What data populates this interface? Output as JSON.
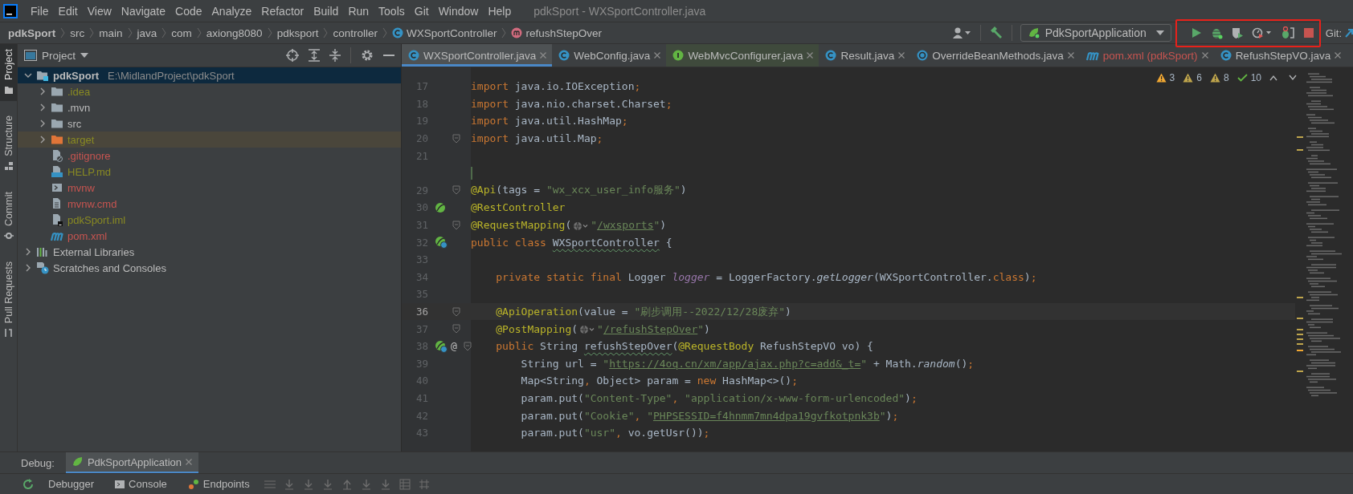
{
  "menu_bar": {
    "items": [
      "File",
      "Edit",
      "View",
      "Navigate",
      "Code",
      "Analyze",
      "Refactor",
      "Build",
      "Run",
      "Tools",
      "Git",
      "Window",
      "Help"
    ],
    "title": "pdkSport - WXSportController.java"
  },
  "breadcrumbs": [
    {
      "label": "pdkSport",
      "kind": "project"
    },
    {
      "label": "src",
      "kind": "folder"
    },
    {
      "label": "main",
      "kind": "folder"
    },
    {
      "label": "java",
      "kind": "folder"
    },
    {
      "label": "com",
      "kind": "folder"
    },
    {
      "label": "axiong8080",
      "kind": "folder"
    },
    {
      "label": "pdksport",
      "kind": "folder"
    },
    {
      "label": "controller",
      "kind": "folder"
    },
    {
      "label": "WXSportController",
      "kind": "class"
    },
    {
      "label": "refushStepOver",
      "kind": "method"
    }
  ],
  "toolbar": {
    "run_config": "PdkSportApplication",
    "git_label": "Git:"
  },
  "side_stripe": [
    {
      "label": "Project",
      "kind": "project",
      "selected": true
    },
    {
      "label": "Structure",
      "kind": "structure",
      "selected": false
    },
    {
      "label": "Commit",
      "kind": "commit",
      "selected": false
    },
    {
      "label": "Pull Requests",
      "kind": "pull_requests",
      "selected": false
    }
  ],
  "project_panel": {
    "title": "Project",
    "tree": [
      {
        "label": "pdkSport",
        "path": "E:\\MidlandProject\\pdkSport",
        "kind": "module",
        "expanded": true,
        "selected": true,
        "color": "#bbbbbb",
        "children": [
          {
            "label": ".idea",
            "kind": "folder",
            "expanded": false,
            "selected": false,
            "color": "#898a22"
          },
          {
            "label": ".mvn",
            "kind": "folder",
            "expanded": false,
            "selected": false,
            "color": "#bbbbbb"
          },
          {
            "label": "src",
            "kind": "folder",
            "expanded": false,
            "selected": false,
            "color": "#bbbbbb"
          },
          {
            "label": "target",
            "kind": "excluded_folder",
            "expanded": false,
            "selected": false,
            "color": "#898a22"
          },
          {
            "label": ".gitignore",
            "kind": "file_ignore",
            "selected": false,
            "color": "#c75450"
          },
          {
            "label": "HELP.md",
            "kind": "file_md",
            "selected": false,
            "color": "#898a22"
          },
          {
            "label": "mvnw",
            "kind": "file_script",
            "selected": false,
            "color": "#c75450"
          },
          {
            "label": "mvnw.cmd",
            "kind": "file_text",
            "selected": false,
            "color": "#c75450"
          },
          {
            "label": "pdkSport.iml",
            "kind": "file_iml",
            "selected": false,
            "color": "#898a22"
          },
          {
            "label": "pom.xml",
            "kind": "file_maven",
            "selected": false,
            "color": "#c75450"
          }
        ]
      },
      {
        "label": "External Libraries",
        "kind": "libraries",
        "expanded": false,
        "selected": false,
        "color": "#bbbbbb"
      },
      {
        "label": "Scratches and Consoles",
        "kind": "scratches",
        "expanded": false,
        "selected": false,
        "color": "#bbbbbb"
      }
    ]
  },
  "editor_tabs": [
    {
      "label": "WXSportController.java",
      "kind": "class",
      "selected": true,
      "color": "#bbbbbb"
    },
    {
      "label": "WebConfig.java",
      "kind": "class",
      "selected": false,
      "color": "#bbbbbb"
    },
    {
      "label": "WebMvcConfigurer.java",
      "kind": "interface_library",
      "selected": false,
      "color": "#bbbbbb"
    },
    {
      "label": "Result.java",
      "kind": "class",
      "selected": false,
      "color": "#bbbbbb"
    },
    {
      "label": "OverrideBeanMethods.java",
      "kind": "class_library",
      "selected": false,
      "color": "#bbbbbb"
    },
    {
      "label": "pom.xml (pdkSport)",
      "kind": "maven",
      "selected": false,
      "color": "#c75450"
    },
    {
      "label": "RefushStepVO.java",
      "kind": "class",
      "selected": false,
      "color": "#bbbbbb"
    }
  ],
  "inspections": [
    {
      "kind": "warning",
      "count": "3"
    },
    {
      "kind": "weak_warning",
      "count": "6"
    },
    {
      "kind": "weak_warning",
      "count": "8"
    },
    {
      "kind": "typo",
      "count": "10"
    }
  ],
  "code_lines": [
    {
      "kind": "code",
      "number": "17",
      "current": false,
      "fold": false,
      "tokens": [
        {
          "kind": "kw",
          "text": "import "
        },
        {
          "kind": "plain",
          "text": "java.io.IOException"
        },
        {
          "kind": "kw",
          "text": ";"
        }
      ]
    },
    {
      "kind": "code",
      "number": "18",
      "current": false,
      "fold": false,
      "tokens": [
        {
          "kind": "kw",
          "text": "import "
        },
        {
          "kind": "plain",
          "text": "java.nio.charset.Charset"
        },
        {
          "kind": "kw",
          "text": ";"
        }
      ]
    },
    {
      "kind": "code",
      "number": "19",
      "current": false,
      "fold": false,
      "tokens": [
        {
          "kind": "kw",
          "text": "import "
        },
        {
          "kind": "plain",
          "text": "java.util.HashMap"
        },
        {
          "kind": "kw",
          "text": ";"
        }
      ]
    },
    {
      "kind": "code",
      "number": "20",
      "current": false,
      "fold": true,
      "tokens": [
        {
          "kind": "kw",
          "text": "import "
        },
        {
          "kind": "plain",
          "text": "java.util.Map"
        },
        {
          "kind": "kw",
          "text": ";"
        }
      ]
    },
    {
      "kind": "code",
      "number": "21",
      "current": false,
      "fold": false
    },
    {
      "kind": "fold_gap"
    },
    {
      "kind": "code",
      "number": "29",
      "current": false,
      "fold": true,
      "tokens": [
        {
          "kind": "ann",
          "text": "@Api"
        },
        {
          "kind": "plain",
          "text": "(tags = "
        },
        {
          "kind": "str",
          "text": "\"wx_xcx_user_info服务\""
        },
        {
          "kind": "plain",
          "text": ")"
        }
      ]
    },
    {
      "kind": "code",
      "number": "30",
      "current": false,
      "fold": false,
      "gutter": {
        "kind": "bean"
      },
      "tokens": [
        {
          "kind": "ann",
          "text": "@RestController"
        }
      ]
    },
    {
      "kind": "code",
      "number": "31",
      "current": false,
      "fold": true,
      "tokens": [
        {
          "kind": "ann",
          "text": "@RequestMapping"
        },
        {
          "kind": "plain",
          "text": "("
        },
        {
          "kind": "inlay"
        },
        {
          "kind": "str",
          "text": "\""
        },
        {
          "kind": "link",
          "text": "/wxsports"
        },
        {
          "kind": "str",
          "text": "\""
        },
        {
          "kind": "plain",
          "text": ")"
        }
      ]
    },
    {
      "kind": "code",
      "number": "32",
      "current": false,
      "fold": false,
      "gutter": {
        "kind": "bean_web"
      },
      "tokens": [
        {
          "kind": "kw",
          "text": "public class "
        },
        {
          "kind": "typo",
          "text": "WXSportController"
        },
        {
          "kind": "plain",
          "text": " {"
        }
      ]
    },
    {
      "kind": "code",
      "number": "33",
      "current": false,
      "fold": false
    },
    {
      "kind": "code",
      "number": "34",
      "current": false,
      "fold": false,
      "tokens": [
        {
          "kind": "indent"
        },
        {
          "kind": "kw",
          "text": "private static final "
        },
        {
          "kind": "plain",
          "text": "Logger "
        },
        {
          "kind": "field",
          "text": "logger"
        },
        {
          "kind": "plain",
          "text": " = LoggerFactory."
        },
        {
          "kind": "italic",
          "text": "getLogger"
        },
        {
          "kind": "plain",
          "text": "(WXSportController."
        },
        {
          "kind": "kw",
          "text": "class"
        },
        {
          "kind": "plain",
          "text": ")"
        },
        {
          "kind": "kw",
          "text": ";"
        }
      ]
    },
    {
      "kind": "code",
      "number": "35",
      "current": false,
      "fold": false
    },
    {
      "kind": "code",
      "number": "36",
      "current": true,
      "fold": true,
      "tokens": [
        {
          "kind": "indent"
        },
        {
          "kind": "ann",
          "text": "@ApiOperation"
        },
        {
          "kind": "plain",
          "text": "(value = "
        },
        {
          "kind": "str",
          "text": "\"刷步调用--2022/12/28废弃\""
        },
        {
          "kind": "plain",
          "text": ")"
        }
      ]
    },
    {
      "kind": "code",
      "number": "37",
      "current": false,
      "fold": true,
      "tokens": [
        {
          "kind": "indent"
        },
        {
          "kind": "ann",
          "text": "@PostMapping"
        },
        {
          "kind": "plain",
          "text": "("
        },
        {
          "kind": "inlay"
        },
        {
          "kind": "str",
          "text": "\""
        },
        {
          "kind": "link",
          "text": "/refushStepOver"
        },
        {
          "kind": "str",
          "text": "\""
        },
        {
          "kind": "plain",
          "text": ")"
        }
      ]
    },
    {
      "kind": "code",
      "number": "38",
      "current": false,
      "fold": true,
      "gutter": {
        "kind": "bean_web"
      },
      "gutter_mark": "@",
      "tokens": [
        {
          "kind": "indent"
        },
        {
          "kind": "kw",
          "text": "public "
        },
        {
          "kind": "plain",
          "text": "String "
        },
        {
          "kind": "typo",
          "text": "refushStepOver"
        },
        {
          "kind": "plain",
          "text": "("
        },
        {
          "kind": "ann",
          "text": "@RequestBody"
        },
        {
          "kind": "plain",
          "text": " RefushStepVO vo) {"
        }
      ]
    },
    {
      "kind": "code",
      "number": "39",
      "current": false,
      "fold": false,
      "tokens": [
        {
          "kind": "indent"
        },
        {
          "kind": "indent"
        },
        {
          "kind": "plain",
          "text": "String url = "
        },
        {
          "kind": "str",
          "text": "\""
        },
        {
          "kind": "link",
          "text": "https://4oq.cn/xm/app/ajax.php?c=add&_t="
        },
        {
          "kind": "str",
          "text": "\""
        },
        {
          "kind": "plain",
          "text": " + Math."
        },
        {
          "kind": "italic",
          "text": "random"
        },
        {
          "kind": "plain",
          "text": "()"
        },
        {
          "kind": "kw",
          "text": ";"
        }
      ]
    },
    {
      "kind": "code",
      "number": "40",
      "current": false,
      "fold": false,
      "tokens": [
        {
          "kind": "indent"
        },
        {
          "kind": "indent"
        },
        {
          "kind": "plain",
          "text": "Map<String"
        },
        {
          "kind": "kw",
          "text": ", "
        },
        {
          "kind": "plain",
          "text": "Object> param = "
        },
        {
          "kind": "kw",
          "text": "new "
        },
        {
          "kind": "plain",
          "text": "HashMap<>()"
        },
        {
          "kind": "kw",
          "text": ";"
        }
      ]
    },
    {
      "kind": "code",
      "number": "41",
      "current": false,
      "fold": false,
      "tokens": [
        {
          "kind": "indent"
        },
        {
          "kind": "indent"
        },
        {
          "kind": "plain",
          "text": "param.put("
        },
        {
          "kind": "str",
          "text": "\"Content-Type\""
        },
        {
          "kind": "kw",
          "text": ", "
        },
        {
          "kind": "str",
          "text": "\"application/x-www-form-urlencoded\""
        },
        {
          "kind": "plain",
          "text": ")"
        },
        {
          "kind": "kw",
          "text": ";"
        }
      ]
    },
    {
      "kind": "code",
      "number": "42",
      "current": false,
      "fold": false,
      "tokens": [
        {
          "kind": "indent"
        },
        {
          "kind": "indent"
        },
        {
          "kind": "plain",
          "text": "param.put("
        },
        {
          "kind": "str",
          "text": "\"Cookie\""
        },
        {
          "kind": "kw",
          "text": ", "
        },
        {
          "kind": "str",
          "text": "\""
        },
        {
          "kind": "strtypo",
          "text": "PHPSESSID=f4hnmm7mn4dpa19gvfkotpnk3b"
        },
        {
          "kind": "str",
          "text": "\""
        },
        {
          "kind": "plain",
          "text": ")"
        },
        {
          "kind": "kw",
          "text": ";"
        }
      ]
    },
    {
      "kind": "code",
      "number": "43",
      "current": false,
      "fold": false,
      "tokens": [
        {
          "kind": "indent"
        },
        {
          "kind": "indent"
        },
        {
          "kind": "plain",
          "text": "param.put("
        },
        {
          "kind": "str",
          "text": "\"usr\""
        },
        {
          "kind": "kw",
          "text": ", "
        },
        {
          "kind": "plain",
          "text": "vo.getUsr())"
        },
        {
          "kind": "kw",
          "text": ";"
        }
      ]
    }
  ],
  "debug_panel": {
    "label": "Debug:",
    "session": "PdkSportApplication",
    "tabs": [
      {
        "label": "Debugger",
        "kind": "debugger"
      },
      {
        "label": "Console",
        "kind": "console"
      },
      {
        "label": "Endpoints",
        "kind": "endpoints"
      }
    ]
  }
}
